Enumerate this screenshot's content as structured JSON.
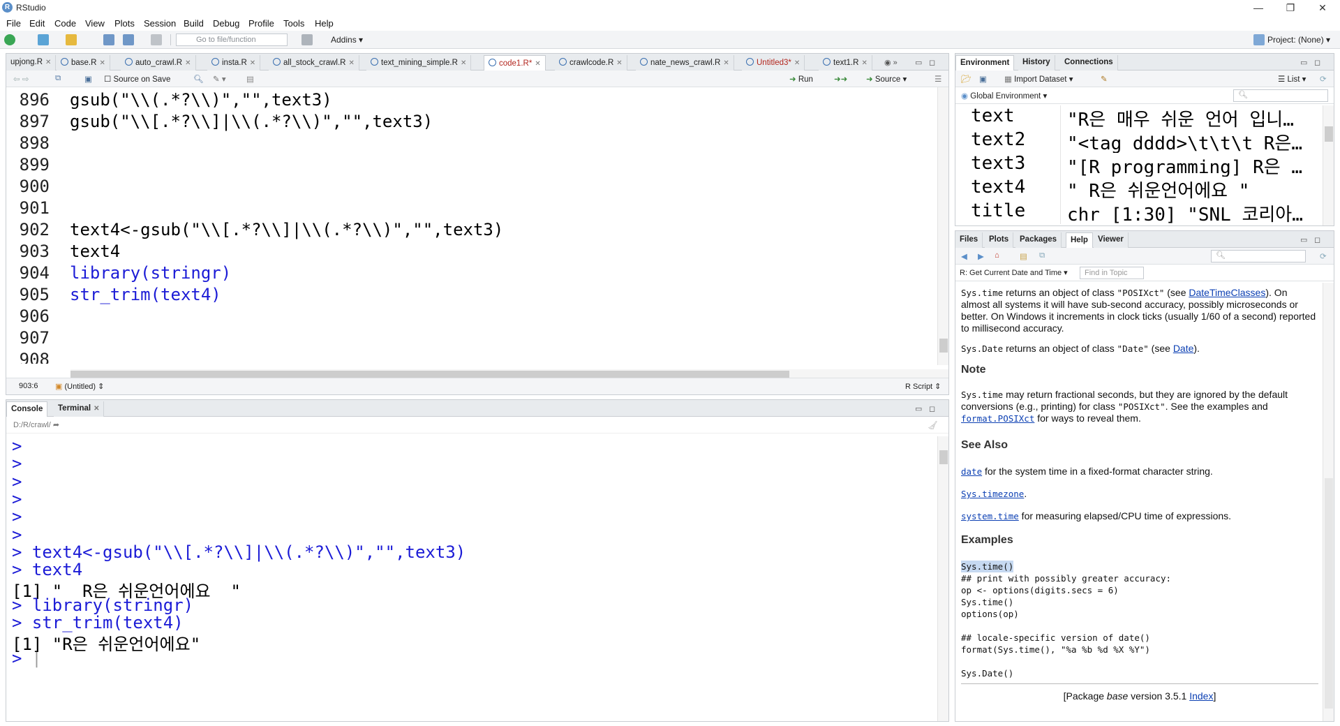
{
  "window": {
    "title": "RStudio",
    "app_icon_glyph": "R",
    "controls": [
      "—",
      "❐",
      "✕"
    ]
  },
  "menu": [
    "File",
    "Edit",
    "Code",
    "View",
    "Plots",
    "Session",
    "Build",
    "Debug",
    "Profile",
    "Tools",
    "Help"
  ],
  "toolbar": {
    "goto_placeholder": "Go to file/function",
    "addins_label": "Addins",
    "project_label": "Project: (None)"
  },
  "editor": {
    "tabs": [
      {
        "label": "upjong.R",
        "unsaved": false
      },
      {
        "label": "base.R",
        "unsaved": false
      },
      {
        "label": "auto_crawl.R",
        "unsaved": false
      },
      {
        "label": "insta.R",
        "unsaved": false
      },
      {
        "label": "all_stock_crawl.R",
        "unsaved": false
      },
      {
        "label": "text_mining_simple.R",
        "unsaved": false
      },
      {
        "label": "code1.R*",
        "unsaved": true
      },
      {
        "label": "crawlcode.R",
        "unsaved": false
      },
      {
        "label": "nate_news_crawl.R",
        "unsaved": false
      },
      {
        "label": "Untitled3*",
        "unsaved": true
      },
      {
        "label": "text1.R",
        "unsaved": false
      }
    ],
    "source_on_save": "Source on Save",
    "run_label": "Run",
    "source_label": "Source",
    "lines": [
      {
        "num": "896",
        "code": "gsub(\"\\\\(.*?\\\\)\",\"\",text3)"
      },
      {
        "num": "897",
        "code": "gsub(\"\\\\[.*?\\\\]|\\\\(.*?\\\\)\",\"\",text3)"
      },
      {
        "num": "898",
        "code": ""
      },
      {
        "num": "899",
        "code": ""
      },
      {
        "num": "900",
        "code": ""
      },
      {
        "num": "901",
        "code": ""
      },
      {
        "num": "902",
        "code": "text4<-gsub(\"\\\\[.*?\\\\]|\\\\(.*?\\\\)\",\"\",text3)"
      },
      {
        "num": "903",
        "code": "text4"
      },
      {
        "num": "904",
        "code": "library(stringr)"
      },
      {
        "num": "905",
        "code": "str_trim(text4)"
      },
      {
        "num": "906",
        "code": ""
      },
      {
        "num": "907",
        "code": ""
      },
      {
        "num": "908",
        "code": ""
      }
    ],
    "status_position": "903:6",
    "status_scope": "(Untitled)",
    "status_type": "R Script"
  },
  "console": {
    "tabs": [
      "Console",
      "Terminal"
    ],
    "path": "D:/R/crawl/",
    "lines": [
      {
        "kind": "prompt",
        "text": ""
      },
      {
        "kind": "prompt",
        "text": ""
      },
      {
        "kind": "prompt",
        "text": ""
      },
      {
        "kind": "prompt",
        "text": ""
      },
      {
        "kind": "prompt",
        "text": ""
      },
      {
        "kind": "prompt",
        "text": ""
      },
      {
        "kind": "cmd",
        "text": "text4<-gsub(\"\\\\[.*?\\\\]|\\\\(.*?\\\\)\",\"\",text3)"
      },
      {
        "kind": "cmd",
        "text": "text4"
      },
      {
        "kind": "out",
        "text": "[1] \"  R은 쉬운언어에요  \""
      },
      {
        "kind": "cmd",
        "text": "library(stringr)"
      },
      {
        "kind": "cmd",
        "text": "str_trim(text4)"
      },
      {
        "kind": "out",
        "text": "[1] \"R은 쉬운언어에요\""
      },
      {
        "kind": "prompt",
        "text": ""
      }
    ]
  },
  "environment": {
    "tabs": [
      "Environment",
      "History",
      "Connections"
    ],
    "import_label": "Import Dataset",
    "list_label": "List",
    "scope_label": "Global Environment",
    "vars": [
      {
        "name": "text",
        "value": "\"R은 매우 쉬운 언어 입니…"
      },
      {
        "name": "text2",
        "value": "\"<tag dddd>\\t\\t\\t R은…"
      },
      {
        "name": "text3",
        "value": "\"[R programming] R은 …"
      },
      {
        "name": "text4",
        "value": "\" R은 쉬운언어에요 \""
      },
      {
        "name": "title",
        "value": "chr [1:30] \"SNL 코리아…"
      }
    ]
  },
  "help": {
    "tabs": [
      "Files",
      "Plots",
      "Packages",
      "Help",
      "Viewer"
    ],
    "topic_label": "R: Get Current Date and Time",
    "find_placeholder": "Find in Topic",
    "p1_code": "Sys.time",
    "p1_a": " returns an object of class ",
    "p1_cls": "\"POSIXct\"",
    "p1_b": " (see ",
    "p1_link": "DateTimeClasses",
    "p1_c": "). On almost all systems it will have sub-second accuracy, possibly microseconds or better. On Windows it increments in clock ticks (usually 1/60 of a second) reported to millisecond accuracy.",
    "p2_code": "Sys.Date",
    "p2_a": " returns an object of class ",
    "p2_cls": "\"Date\"",
    "p2_b": " (see ",
    "p2_link": "Date",
    "p2_c": ").",
    "note_head": "Note",
    "note_code": "Sys.time",
    "note_a": " may return fractional seconds, but they are ignored by the default conversions (e.g., printing) for class ",
    "note_cls": "\"POSIXct\"",
    "note_b": ". See the examples and ",
    "note_link": "format.POSIXct",
    "note_c": " for ways to reveal them.",
    "seealso_head": "See Also",
    "sa1_link": "date",
    "sa1_text": " for the system time in a fixed-format character string.",
    "sa2_link": "Sys.timezone",
    "sa2_text": ".",
    "sa3_link": "system.time",
    "sa3_text": " for measuring elapsed/CPU time of expressions.",
    "examples_head": "Examples",
    "examples": [
      "Sys.time()",
      "## print with possibly greater accuracy:",
      "op <- options(digits.secs = 6)",
      "Sys.time()",
      "options(op)",
      "",
      "## locale-specific version of date()",
      "format(Sys.time(), \"%a %b %d %X %Y\")",
      "",
      "Sys.Date()"
    ],
    "footer_a": "[Package ",
    "footer_pkg": "base",
    "footer_b": " version 3.5.1 ",
    "footer_link": "Index",
    "footer_c": "]"
  },
  "colors": {
    "accent": "#1b1bd6",
    "string": "#036a07",
    "link": "#0b3fb3",
    "chrome": "#e8ebee"
  }
}
